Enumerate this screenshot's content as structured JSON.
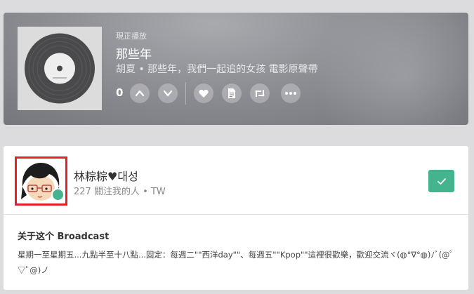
{
  "now_playing": {
    "label": "現正播放",
    "title": "那些年",
    "subtitle": "胡夏 • 那些年，我們一起追的女孩 電影原聲帶",
    "vote_count": "0",
    "cover_icon": "vinyl-record-icon",
    "buttons": [
      "upvote-icon",
      "downvote-icon",
      "heart-icon",
      "document-icon",
      "repost-icon",
      "more-icon"
    ]
  },
  "broadcaster": {
    "name": "林粽粽♥대성",
    "followers_count": "227",
    "followers_label": "關注我的人",
    "separator": "•",
    "region": "TW",
    "follow_icon": "checkmark-icon",
    "accent_color": "#43b48e"
  },
  "about": {
    "title": "关于这个 Broadcast",
    "text": "星期一至星期五...九點半至十八點...固定：每週二\"\"西洋day\"\"、每週五\"\"Kpop\"\"這裡很歡樂，歡迎交流ヾ(◍°∇°◍)ﾉﾞ(@ﾟ▽ﾟ@)ノ"
  }
}
